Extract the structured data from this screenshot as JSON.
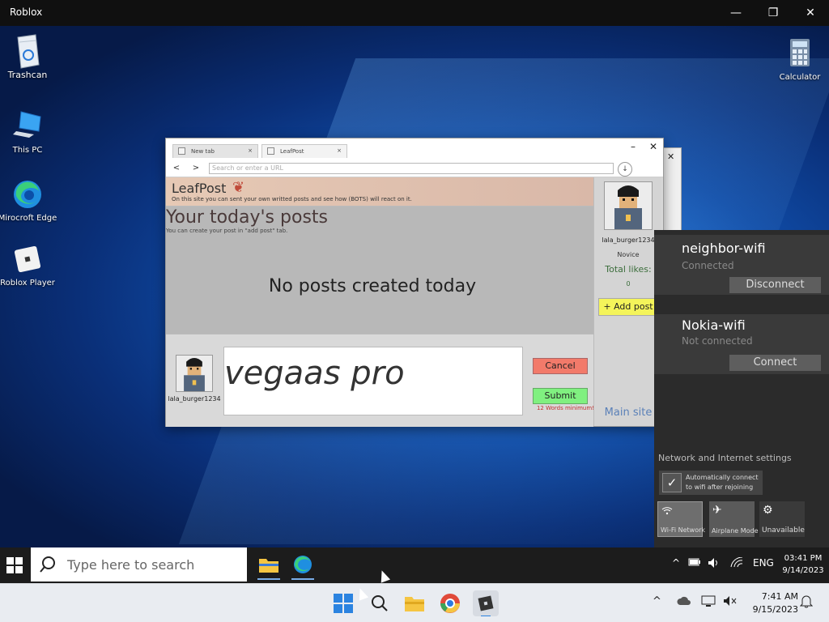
{
  "window": {
    "title": "Roblox",
    "minimize": "—",
    "maximize": "❐",
    "close": "✕"
  },
  "desktop_icons": [
    {
      "label": "Trashcan"
    },
    {
      "label": "This PC"
    },
    {
      "label": "Mirocroft Edge"
    },
    {
      "label": "Roblox Player"
    },
    {
      "label": "Calculator"
    }
  ],
  "browser": {
    "tabs": [
      {
        "label": "New tab",
        "close": "×"
      },
      {
        "label": "LeafPost",
        "close": "×"
      }
    ],
    "back": "<",
    "forward": ">",
    "url_placeholder": "Search or enter a URL",
    "download": "↓",
    "minimize": "–",
    "close": "✕"
  },
  "site": {
    "logo": "LeafPost",
    "logo_mark": "❦",
    "tagline": "On this site you can sent your own writted posts and see how (BOTS) will react on it.",
    "heading": "Your today's posts",
    "subheading": "You can create your post in \"add post\" tab.",
    "empty_message": "No posts created today",
    "user": {
      "username": "lala_burger1234",
      "rank": "Novice",
      "likes_label": "Total likes:",
      "likes_value": "0"
    },
    "add_post_label": "+ Add post",
    "main_site_label": "Main site",
    "composer": {
      "username": "lala_burger1234",
      "text": "vegaas pro",
      "cancel_label": "Cancel",
      "submit_label": "Submit",
      "hint": "12 Words minimum!"
    }
  },
  "peek_window": {
    "close": "✕"
  },
  "wifi_panel": {
    "networks": [
      {
        "ssid": "neighbor-wifi",
        "status": "Connected",
        "action": "Disconnect"
      },
      {
        "ssid": "Nokia-wifi",
        "status": "Not connected",
        "action": "Connect"
      }
    ],
    "settings_label": "Network and Internet settings",
    "auto_connect_label": "Automatically connect to wifi after rejoining",
    "check": "✓",
    "quick_actions": [
      {
        "label": "Wi-Fi Network",
        "icon": "wifi-icon"
      },
      {
        "label": "Airplane Mode",
        "icon": "airplane-icon"
      },
      {
        "label": "Unavailable",
        "icon": "gear-icon"
      }
    ]
  },
  "inner_taskbar": {
    "search_placeholder": "Type here to search",
    "tray_chevron": "^",
    "language": "ENG",
    "time": "03:41 PM",
    "date": "9/14/2023"
  },
  "outer_taskbar": {
    "tray_chevron": "^",
    "time": "7:41 AM",
    "date": "9/15/2023"
  }
}
